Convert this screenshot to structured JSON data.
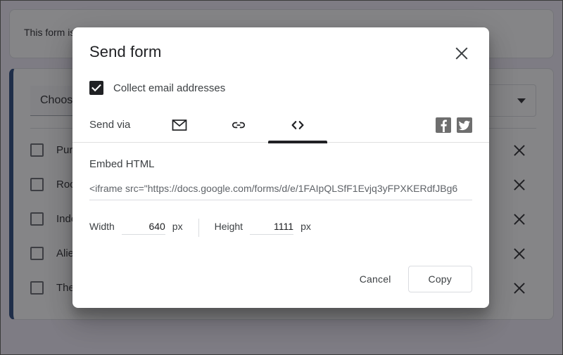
{
  "background": {
    "notice_text": "This form is automatically collecting emails for Wayne State University users. Change settings",
    "question_title": "Choose your favorite movies",
    "question_type": "Checkboxes",
    "options": [
      {
        "label": "Pursuit of Happyness"
      },
      {
        "label": "Rocky"
      },
      {
        "label": "Independence Day"
      },
      {
        "label": "Aliens"
      },
      {
        "label": "The Road"
      }
    ],
    "remove_icon_name": "close-icon"
  },
  "dialog": {
    "title": "Send form",
    "close_label": "Close",
    "collect_email": {
      "label": "Collect email addresses",
      "checked": true
    },
    "send_via": {
      "label": "Send via",
      "tabs": [
        {
          "id": "email",
          "icon": "envelope-icon",
          "active": false
        },
        {
          "id": "link",
          "icon": "link-icon",
          "active": false
        },
        {
          "id": "embed",
          "icon": "code-icon",
          "active": true
        }
      ],
      "social": [
        {
          "id": "facebook",
          "icon": "facebook-icon",
          "glyph": "f"
        },
        {
          "id": "twitter",
          "icon": "twitter-icon",
          "glyph": "bird"
        }
      ]
    },
    "embed": {
      "title": "Embed HTML",
      "value": "<iframe src=\"https://docs.google.com/forms/d/e/1FAIpQLSfF1Evjq3yFPXKERdfJBg6",
      "placeholder": "Embed HTML",
      "width_label": "Width",
      "width_value": "640",
      "width_unit": "px",
      "height_label": "Height",
      "height_value": "1111",
      "height_unit": "px"
    },
    "footer": {
      "cancel_label": "Cancel",
      "copy_label": "Copy"
    }
  },
  "colors": {
    "accent_blue": "#1d3f75",
    "scrim": "rgba(32,33,36,0.55)",
    "text_primary": "#202124",
    "text_secondary": "#3c4043",
    "social_gray": "#6e6e6e"
  }
}
